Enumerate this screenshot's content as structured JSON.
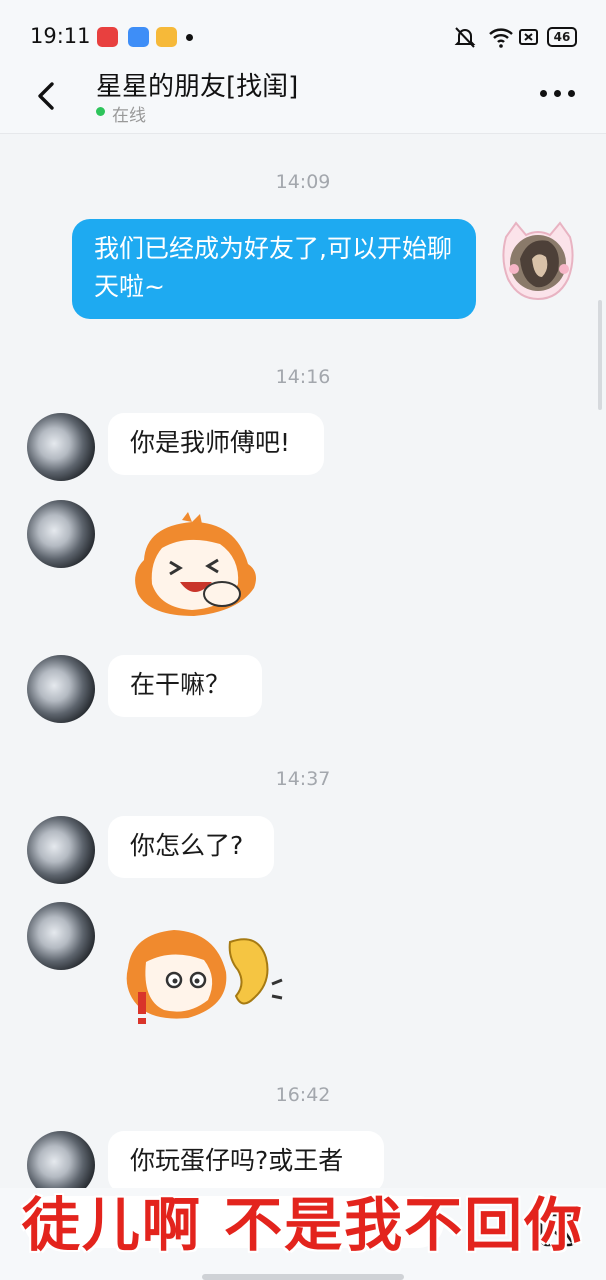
{
  "status_bar": {
    "time": "19:11",
    "battery": "46",
    "icons": [
      "screen-record-icon",
      "app-blue-icon",
      "notes-icon",
      "notification-dot",
      "mute-bell-icon",
      "wifi-icon",
      "battery-saver-icon",
      "battery-icon"
    ]
  },
  "header": {
    "title": "星星的朋友[找闺]",
    "status": "在线",
    "back_icon": "chevron-left-icon",
    "more_icon": "more-dots-icon"
  },
  "messages": {
    "ts_1": "14:09",
    "out_1": "我们已经成为好友了,可以开始聊天啦~",
    "ts_2": "14:16",
    "in_1": "你是我师傅吧!",
    "sticker_1": "laughing-cartoon-sticker",
    "in_2": "在干嘛？",
    "ts_3": "14:37",
    "in_3": "你怎么了?",
    "sticker_2": "listening-ear-cartoon-sticker",
    "ts_4": "16:42",
    "in_4": "你玩蛋仔吗?或王者"
  },
  "subtitle": "徒儿啊 不是我不回你",
  "colors": {
    "accent": "#1eaaf1",
    "online": "#2ec45b",
    "subtitle": "#e3241d",
    "background": "#f3f5f7"
  }
}
